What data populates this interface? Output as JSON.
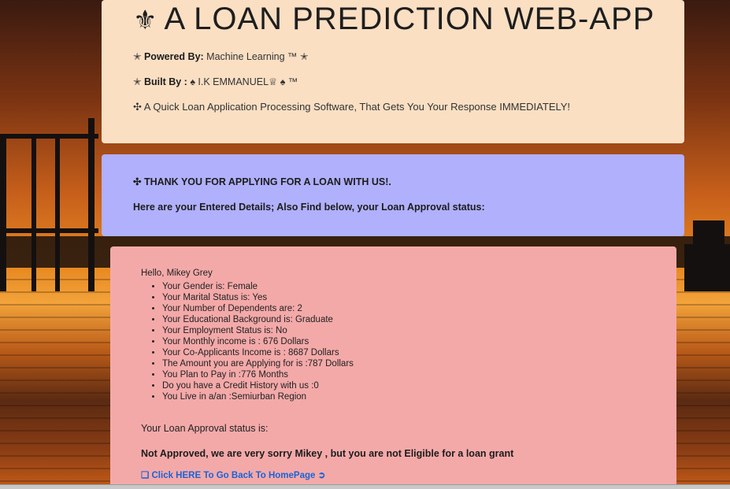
{
  "header": {
    "logo_glyph": "⚜",
    "title": "A LOAN PREDICTION WEB-APP",
    "powered_prefix": "✭",
    "powered_label": "Powered By:",
    "powered_value": "Machine Learning ™ ✭",
    "built_prefix": "✭",
    "built_label": "Built By :",
    "built_value": "♠ I.K EMMANUEL♕ ♠ ™",
    "tagline": "✣ A Quick Loan Application Processing Software, That Gets You Your Response IMMEDIATELY!"
  },
  "thanks": {
    "title": "✣ THANK YOU FOR APPLYING FOR A LOAN WITH US!.",
    "subtitle": "Here are your Entered Details; Also Find below, your Loan Approval status:"
  },
  "result": {
    "greeting": "Hello, Mikey Grey",
    "details": [
      "Your Gender is: Female",
      "Your Marital Status is: Yes",
      "Your Number of Dependents are: 2",
      "Your Educational Background is: Graduate",
      "Your Employment Status is: No",
      "Your Monthly income is : 676 Dollars",
      "Your Co-Applicants Income is : 8687 Dollars",
      "The Amount you are Applying for is :787 Dollars",
      "You Plan to Pay in :776 Months",
      "Do you have a Credit History with us :0",
      "You Live in a/an :Semiurban Region"
    ],
    "status_label": "Your Loan Approval status is:",
    "status_value": "Not Approved, we are very sorry Mikey , but you are not Eligible for a loan grant",
    "home_link": "❑ Click HERE To Go Back To HomePage ➲"
  },
  "colors": {
    "header_bg": "#fadfc3",
    "thanks_bg": "#b0b0fc",
    "result_bg": "#f4a9a9",
    "link": "#1a63d6"
  }
}
